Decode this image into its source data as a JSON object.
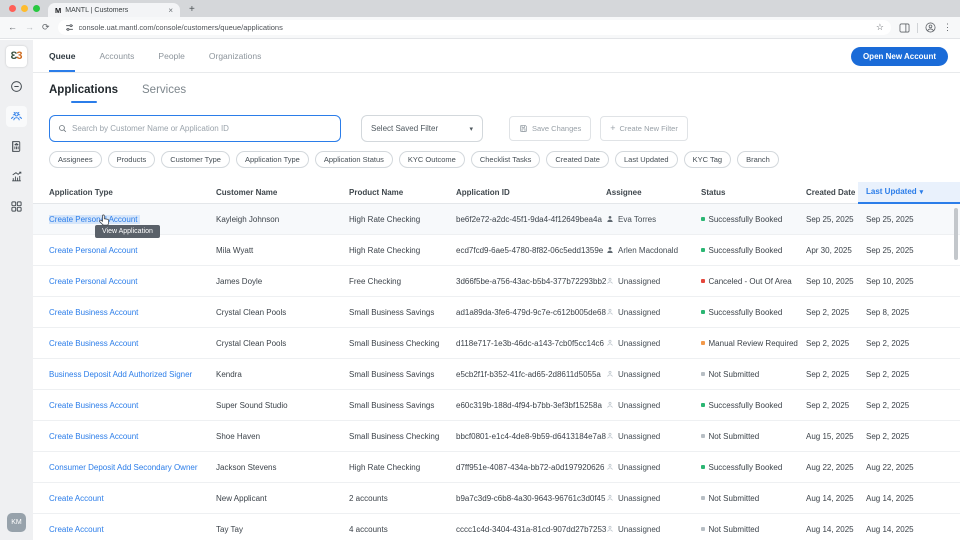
{
  "browser": {
    "tab_title": "MANTL | Customers",
    "favicon_letter": "M",
    "url": "console.uat.mantl.com/console/customers/queue/applications"
  },
  "sidebar": {
    "logo_left": "Ɛ",
    "logo_right": "3",
    "avatar_initials": "KM"
  },
  "top_nav": {
    "items": [
      {
        "label": "Queue",
        "active": true
      },
      {
        "label": "Accounts",
        "active": false
      },
      {
        "label": "People",
        "active": false
      },
      {
        "label": "Organizations",
        "active": false
      }
    ],
    "open_new_account_label": "Open New Account"
  },
  "page_tabs": {
    "applications": "Applications",
    "services": "Services"
  },
  "toolbar": {
    "search_placeholder": "Search by Customer Name or Application ID",
    "saved_filter_label": "Select Saved Filter",
    "save_changes_label": "Save Changes",
    "create_new_filter_label": "Create New Filter"
  },
  "filters": [
    "Assignees",
    "Products",
    "Customer Type",
    "Application Type",
    "Application Status",
    "KYC Outcome",
    "Checklist Tasks",
    "Created Date",
    "Last Updated",
    "KYC Tag",
    "Branch"
  ],
  "tooltip_text": "View Application",
  "table": {
    "columns": [
      {
        "label": "Application Type"
      },
      {
        "label": "Customer Name"
      },
      {
        "label": "Product Name"
      },
      {
        "label": "Application ID"
      },
      {
        "label": "Assignee"
      },
      {
        "label": "Status"
      },
      {
        "label": "Created Date",
        "sortable": true
      },
      {
        "label": "Last Updated",
        "sortable": true,
        "sort_active": true
      }
    ],
    "rows": [
      {
        "application_type": "Create Personal Account",
        "customer_name": "Kayleigh Johnson",
        "product_name": "High Rate Checking",
        "application_id": "be6f2e72-a2dc-45f1-9da4-4f12649bea4a",
        "assignee": "Eva Torres",
        "assigned": true,
        "status": "Successfully Booked",
        "status_type": "success",
        "created_date": "Sep 25, 2025",
        "last_updated": "Sep 25, 2025",
        "hovered": true
      },
      {
        "application_type": "Create Personal Account",
        "customer_name": "Mila Wyatt",
        "product_name": "High Rate Checking",
        "application_id": "ecd7fcd9-6ae5-4780-8f82-06c5edd1359e",
        "assignee": "Arlen Macdonald",
        "assigned": true,
        "status": "Successfully Booked",
        "status_type": "success",
        "created_date": "Apr 30, 2025",
        "last_updated": "Sep 25, 2025",
        "hovered": false
      },
      {
        "application_type": "Create Personal Account",
        "customer_name": "James Doyle",
        "product_name": "Free Checking",
        "application_id": "3d66f5be-a756-43ac-b5b4-377b72293bb2",
        "assignee": "Unassigned",
        "assigned": false,
        "status": "Canceled - Out Of Area",
        "status_type": "error",
        "created_date": "Sep 10, 2025",
        "last_updated": "Sep 10, 2025",
        "hovered": false
      },
      {
        "application_type": "Create Business Account",
        "customer_name": "Crystal Clean Pools",
        "product_name": "Small Business Savings",
        "application_id": "ad1a89da-3fe6-479d-9c7e-c612b005de68",
        "assignee": "Unassigned",
        "assigned": false,
        "status": "Successfully Booked",
        "status_type": "success",
        "created_date": "Sep 2, 2025",
        "last_updated": "Sep 8, 2025",
        "hovered": false
      },
      {
        "application_type": "Create Business Account",
        "customer_name": "Crystal Clean Pools",
        "product_name": "Small Business Checking",
        "application_id": "d118e717-1e3b-46dc-a143-7cb0f5cc14c6",
        "assignee": "Unassigned",
        "assigned": false,
        "status": "Manual Review Required",
        "status_type": "warning",
        "created_date": "Sep 2, 2025",
        "last_updated": "Sep 2, 2025",
        "hovered": false
      },
      {
        "application_type": "Business Deposit Add Authorized Signer",
        "customer_name": "Kendra",
        "product_name": "Small Business Savings",
        "application_id": "e5cb2f1f-b352-41fc-ad65-2d8611d5055a",
        "assignee": "Unassigned",
        "assigned": false,
        "status": "Not Submitted",
        "status_type": "neutral",
        "created_date": "Sep 2, 2025",
        "last_updated": "Sep 2, 2025",
        "hovered": false
      },
      {
        "application_type": "Create Business Account",
        "customer_name": "Super Sound Studio",
        "product_name": "Small Business Savings",
        "application_id": "e60c319b-188d-4f94-b7bb-3ef3bf15258a",
        "assignee": "Unassigned",
        "assigned": false,
        "status": "Successfully Booked",
        "status_type": "success",
        "created_date": "Sep 2, 2025",
        "last_updated": "Sep 2, 2025",
        "hovered": false
      },
      {
        "application_type": "Create Business Account",
        "customer_name": "Shoe Haven",
        "product_name": "Small Business Checking",
        "application_id": "bbcf0801-e1c4-4de8-9b59-d6413184e7a8",
        "assignee": "Unassigned",
        "assigned": false,
        "status": "Not Submitted",
        "status_type": "neutral",
        "created_date": "Aug 15, 2025",
        "last_updated": "Sep 2, 2025",
        "hovered": false
      },
      {
        "application_type": "Consumer Deposit Add Secondary Owner",
        "customer_name": "Jackson Stevens",
        "product_name": "High Rate Checking",
        "application_id": "d7ff951e-4087-434a-bb72-a0d197920626",
        "assignee": "Unassigned",
        "assigned": false,
        "status": "Successfully Booked",
        "status_type": "success",
        "created_date": "Aug 22, 2025",
        "last_updated": "Aug 22, 2025",
        "hovered": false
      },
      {
        "application_type": "Create Account",
        "customer_name": "New Applicant",
        "product_name": "2 accounts",
        "application_id": "b9a7c3d9-c6b8-4a30-9643-96761c3d0f45",
        "assignee": "Unassigned",
        "assigned": false,
        "status": "Not Submitted",
        "status_type": "neutral",
        "created_date": "Aug 14, 2025",
        "last_updated": "Aug 14, 2025",
        "hovered": false
      },
      {
        "application_type": "Create Account",
        "customer_name": "Tay Tay",
        "product_name": "4 accounts",
        "application_id": "cccc1c4d-3404-431a-81cd-907dd27b7253",
        "assignee": "Unassigned",
        "assigned": false,
        "status": "Not Submitted",
        "status_type": "neutral",
        "created_date": "Aug 14, 2025",
        "last_updated": "Aug 14, 2025",
        "hovered": false
      }
    ]
  },
  "colors": {
    "accent": "#2b7de9",
    "primary_button": "#1a6bd8",
    "status": {
      "success": "#2bb673",
      "error": "#e5483d",
      "warning": "#f2994a",
      "neutral": "#b7bec4"
    }
  }
}
